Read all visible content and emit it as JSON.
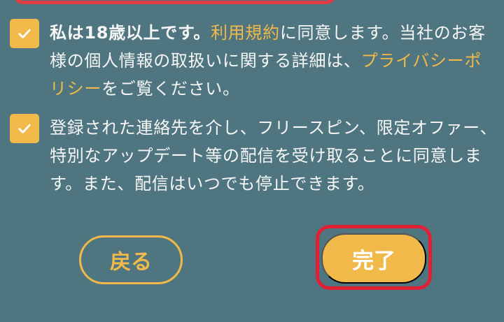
{
  "consent_terms": {
    "checked": true,
    "text_bold": "私は18歳以上です。",
    "text_1": "",
    "link_terms": "利用規約",
    "text_2": "に同意します。当社のお客様の個人情報の取扱いに関する詳細は、",
    "link_privacy": "プライバシーポリシー",
    "text_3": "をご覧ください。"
  },
  "consent_marketing": {
    "checked": true,
    "text": "登録された連絡先を介し、フリースピン、限定オファー、特別なアップデート等の配信を受け取ることに同意します。また、配信はいつでも停止できます。"
  },
  "buttons": {
    "back_label": "戻る",
    "done_label": "完了"
  },
  "colors": {
    "background": "#4f7680",
    "accent": "#f0b94a",
    "highlight": "#e11f35",
    "text": "#f6f6f6"
  },
  "icons": {
    "checkbox_check": "check-icon"
  }
}
